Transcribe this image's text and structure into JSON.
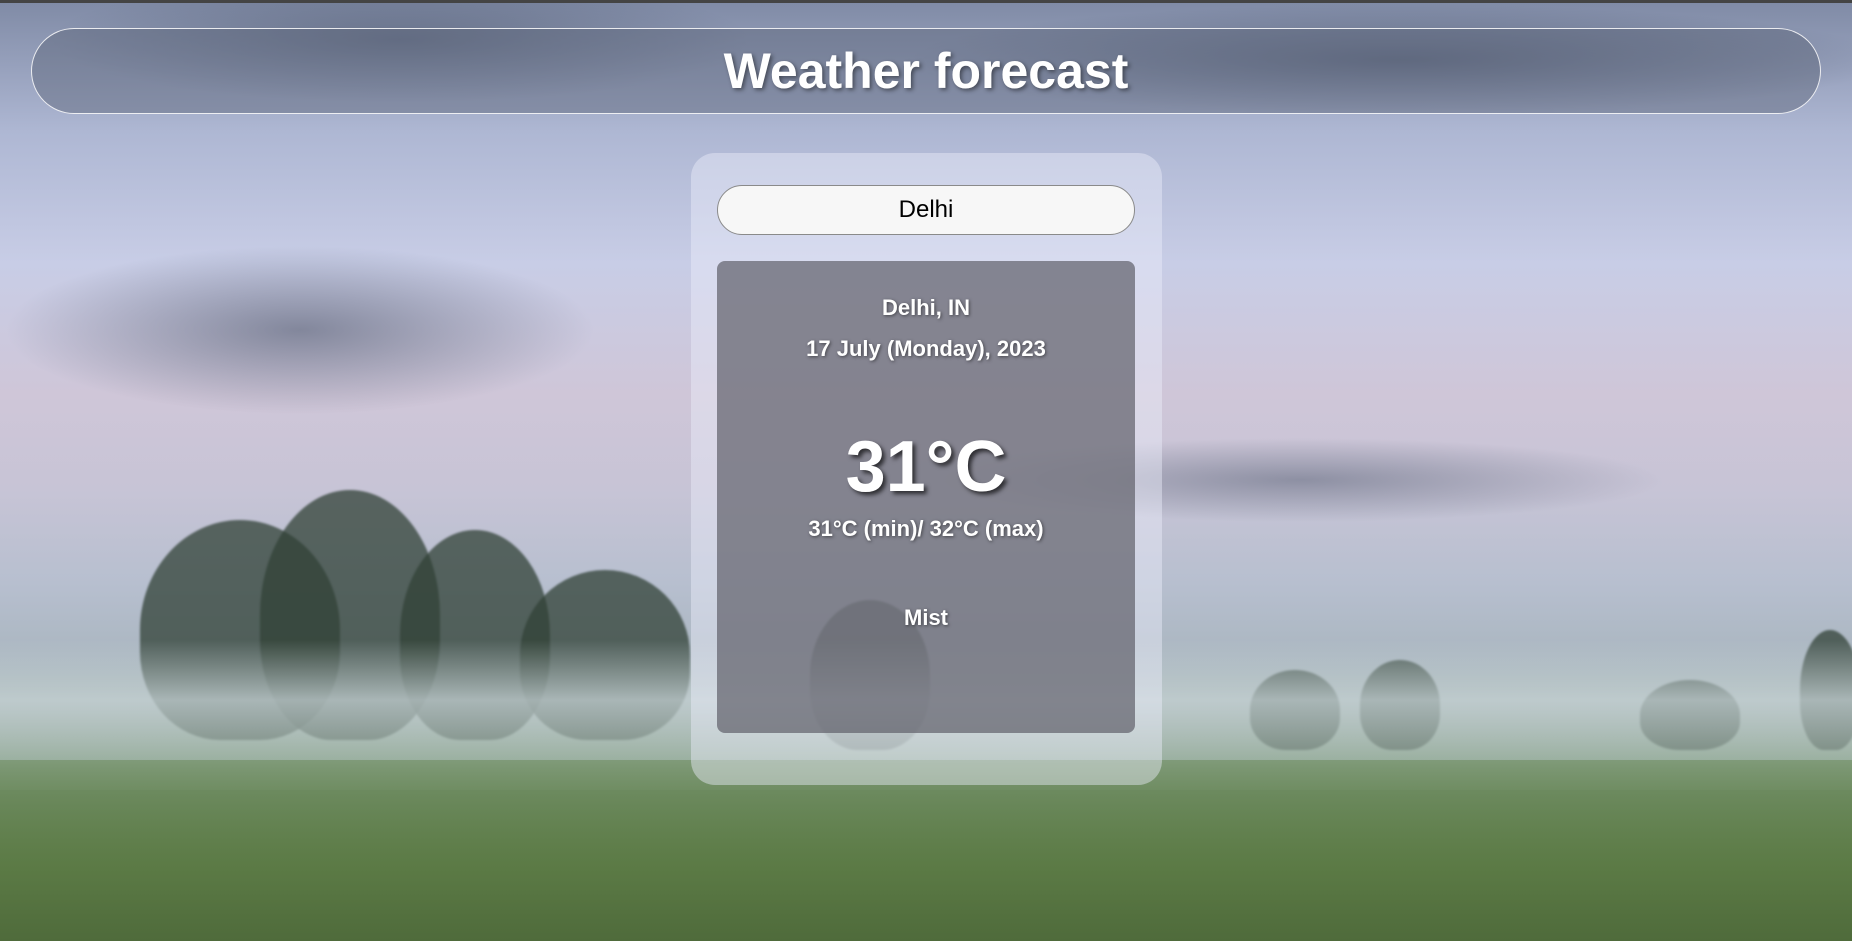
{
  "header": {
    "title": "Weather forecast"
  },
  "search": {
    "value": "Delhi"
  },
  "weather": {
    "location": "Delhi, IN",
    "date": "17 July (Monday), 2023",
    "temperature": "31°C",
    "min_max": "31°C (min)/ 32°C (max)",
    "condition": "Mist"
  },
  "background": {
    "scene": "misty-meadow-photo"
  }
}
